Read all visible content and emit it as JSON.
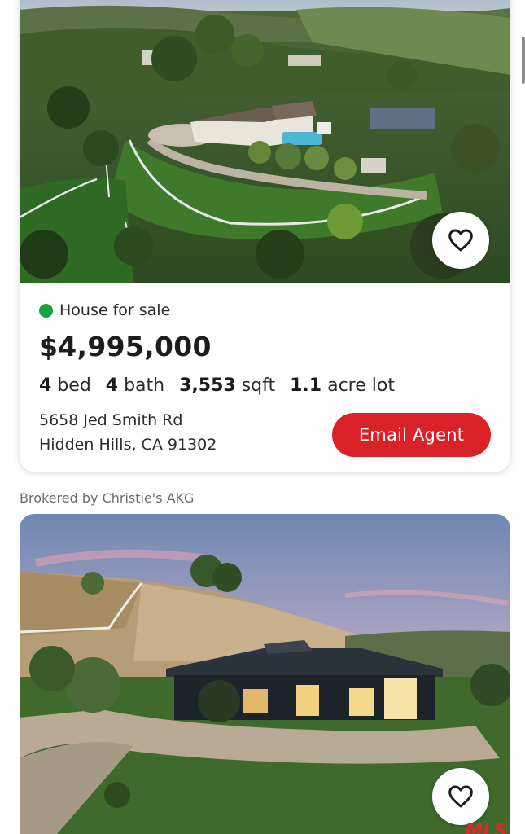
{
  "listings": [
    {
      "status": "House for sale",
      "status_color": "#1aa33c",
      "price": "$4,995,000",
      "beds_value": "4",
      "beds_unit": "bed",
      "baths_value": "4",
      "baths_unit": "bath",
      "sqft_value": "3,553",
      "sqft_unit": "sqft",
      "lot_value": "1.1",
      "lot_unit": "acre lot",
      "address_line1": "5658 Jed Smith Rd",
      "address_line2": "Hidden Hills, CA 91302",
      "cta_label": "Email Agent",
      "cta_color": "#d92228",
      "favorite_icon": "heart-outline-icon"
    }
  ],
  "brokered_by": "Brokered by Christie's AKG",
  "next_listing": {
    "favorite_icon": "heart-outline-icon",
    "logo_text": "MLS"
  }
}
